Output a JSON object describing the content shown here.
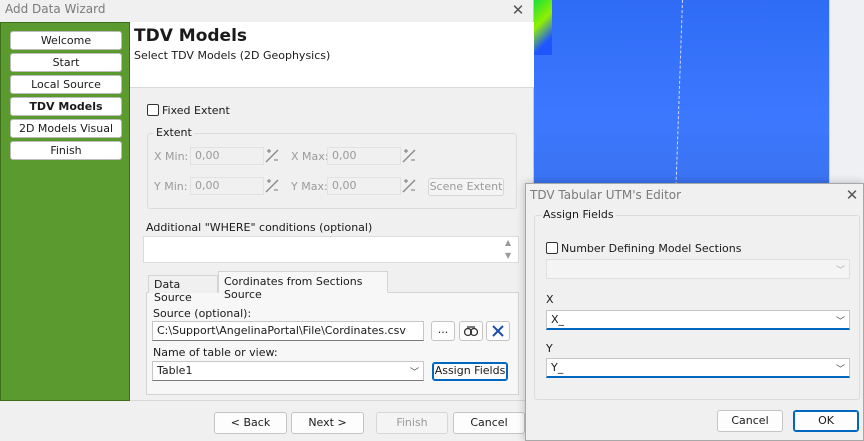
{
  "wizard": {
    "title": "Add Data Wizard",
    "nav": [
      "Welcome",
      "Start",
      "Local Source",
      "TDV Models",
      "2D Models Visual",
      "Finish"
    ],
    "active_nav": "TDV Models",
    "header_title": "TDV Models",
    "header_subtitle": "Select TDV Models (2D Geophysics)",
    "fixed_extent_label": "Fixed Extent",
    "extent_group_label": "Extent",
    "xmin_label": "X Min:",
    "xmin_value": "0,00",
    "xmax_label": "X Max:",
    "xmax_value": "0,00",
    "ymin_label": "Y Min:",
    "ymin_value": "0,00",
    "ymax_label": "Y Max:",
    "ymax_value": "0,00",
    "scene_extent_label": "Scene Extent",
    "where_label": "Additional \"WHERE\" conditions (optional)",
    "where_value": "",
    "tabs": [
      "Data Source",
      "Cordinates from Sections Source"
    ],
    "active_tab": "Cordinates from Sections Source",
    "source_label": "Source (optional):",
    "source_value": "C:\\Support\\AngelinaPortal\\File\\Cordinates.csv",
    "browse_label": "...",
    "table_label": "Name of table or view:",
    "table_value": "Table1",
    "assign_fields_label": "Assign Fields",
    "back_label": "< Back",
    "next_label": "Next >",
    "finish_label": "Finish",
    "cancel_label": "Cancel",
    "accent_color": "#0067c0",
    "sidebar_color": "#5b9a2e"
  },
  "editor": {
    "title": "TDV Tabular UTM's Editor",
    "group_label": "Assign Fields",
    "number_defining_label": "Number Defining Model Sections",
    "number_defining_value": "",
    "x_label": "X",
    "x_value": "X_",
    "y_label": "Y",
    "y_value": "Y_",
    "cancel_label": "Cancel",
    "ok_label": "OK"
  },
  "icons": {
    "close": "close-icon",
    "calc": "calculator-icon",
    "link": "link-icon",
    "clear": "clear-icon",
    "scroll_up": "scroll-up-icon",
    "scroll_down": "scroll-down-icon",
    "dropdown": "chevron-down-icon"
  }
}
